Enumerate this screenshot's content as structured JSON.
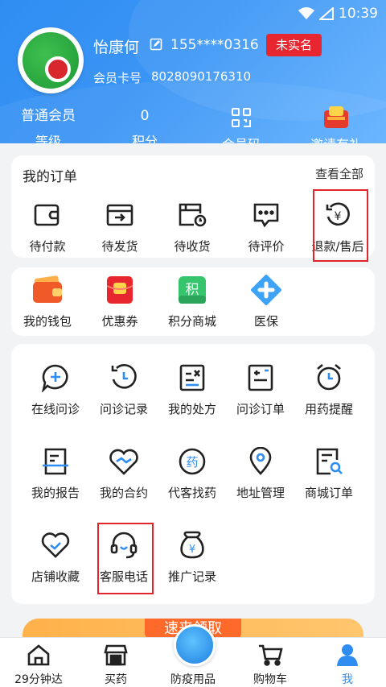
{
  "status_bar": {
    "time": "10:39"
  },
  "profile": {
    "name": "怡康何",
    "phone": "155****0316",
    "verify_badge": "未实名",
    "card_label": "会员卡号",
    "card_number": "8028090176310"
  },
  "stats": [
    {
      "value": "普通会员",
      "label": "等级"
    },
    {
      "value": "0",
      "label": "积分"
    },
    {
      "icon": "qr-code-icon",
      "label": "会员码"
    },
    {
      "icon": "gift-coupon-icon",
      "label": "邀请有礼"
    }
  ],
  "orders": {
    "title": "我的订单",
    "view_all": "查看全部",
    "items": [
      {
        "label": "待付款",
        "icon": "wallet-icon"
      },
      {
        "label": "待发货",
        "icon": "box-ship-icon"
      },
      {
        "label": "待收货",
        "icon": "delivery-clock-icon"
      },
      {
        "label": "待评价",
        "icon": "comment-icon"
      },
      {
        "label": "退款/售后",
        "icon": "refund-icon"
      }
    ]
  },
  "wallet_row": [
    {
      "label": "我的钱包",
      "icon": "wallet-icon"
    },
    {
      "label": "优惠券",
      "icon": "coupon-icon"
    },
    {
      "label": "积分商城",
      "icon": "points-mall-icon",
      "glyph": "积"
    },
    {
      "label": "医保",
      "icon": "medical-insurance-icon"
    }
  ],
  "services": [
    {
      "label": "在线问诊",
      "icon": "consult-icon"
    },
    {
      "label": "问诊记录",
      "icon": "history-icon"
    },
    {
      "label": "我的处方",
      "icon": "prescription-icon"
    },
    {
      "label": "问诊订单",
      "icon": "consult-order-icon"
    },
    {
      "label": "用药提醒",
      "icon": "alarm-icon"
    },
    {
      "label": "我的报告",
      "icon": "report-icon"
    },
    {
      "label": "我的合约",
      "icon": "handshake-icon"
    },
    {
      "label": "代客找药",
      "icon": "find-medicine-icon",
      "glyph": "药"
    },
    {
      "label": "地址管理",
      "icon": "location-icon"
    },
    {
      "label": "商城订单",
      "icon": "mall-order-icon"
    },
    {
      "label": "店铺收藏",
      "icon": "heart-icon"
    },
    {
      "label": "客服电话",
      "icon": "headset-icon"
    },
    {
      "label": "推广记录",
      "icon": "money-bag-icon",
      "glyph": "¥"
    }
  ],
  "banner": {
    "text": "速来领取"
  },
  "tabbar": [
    {
      "label": "29分钟达",
      "icon": "home-icon"
    },
    {
      "label": "买药",
      "icon": "shop-icon"
    },
    {
      "label": "防疫用品",
      "icon": "center-icon"
    },
    {
      "label": "购物车",
      "icon": "cart-icon"
    },
    {
      "label": "我",
      "icon": "user-icon"
    }
  ],
  "colors": {
    "primary": "#2f8df2",
    "badge": "#e8262f",
    "highlight": "#e2242b"
  }
}
